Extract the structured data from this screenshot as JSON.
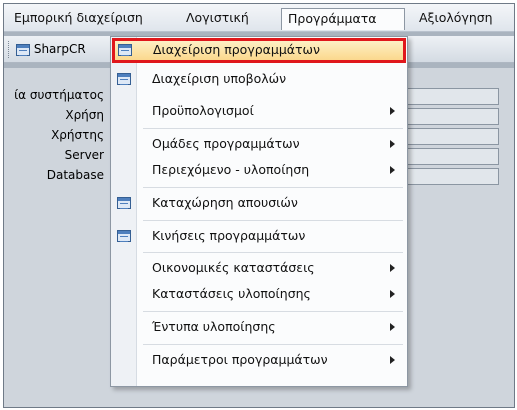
{
  "menubar": {
    "items": [
      {
        "label": "Εμπορική διαχείριση"
      },
      {
        "label": "Λογιστική"
      },
      {
        "label": "Προγράμματα"
      },
      {
        "label": "Αξιολόγηση"
      }
    ]
  },
  "toolbar": {
    "button_label": "SharpCR",
    "button_icon": "form-icon"
  },
  "form": {
    "labels": [
      "ία συστήματος",
      "Χρήση",
      "Χρήστης",
      "Server",
      "Database"
    ]
  },
  "dropdown": {
    "items": [
      {
        "label": "Διαχείριση προγραμμάτων",
        "icon": "form-icon",
        "submenu": false,
        "selected": true
      },
      {
        "label": "Διαχείριση υποβολών",
        "icon": "form-icon",
        "submenu": false
      },
      {
        "label": "Προϋπολογισμοί",
        "icon": "",
        "submenu": true
      },
      {
        "label": "Ομάδες προγραμμάτων",
        "icon": "",
        "submenu": true
      },
      {
        "label": "Περιεχόμενο - υλοποίηση",
        "icon": "",
        "submenu": true
      },
      {
        "label": "Καταχώρηση απουσιών",
        "icon": "form-icon",
        "submenu": false
      },
      {
        "label": "Κινήσεις προγραμμάτων",
        "icon": "form-icon",
        "submenu": false
      },
      {
        "label": "Οικονομικές καταστάσεις",
        "icon": "",
        "submenu": true
      },
      {
        "label": "Καταστάσεις υλοποίησης",
        "icon": "",
        "submenu": true
      },
      {
        "label": "Έντυπα υλοποίησης",
        "icon": "",
        "submenu": true
      },
      {
        "label": "Παράμετροι προγραμμάτων",
        "icon": "",
        "submenu": true
      }
    ]
  },
  "colors": {
    "highlight_border": "#e0171b",
    "highlight_fill": "#fbd88d",
    "background": "#aab4bf"
  }
}
